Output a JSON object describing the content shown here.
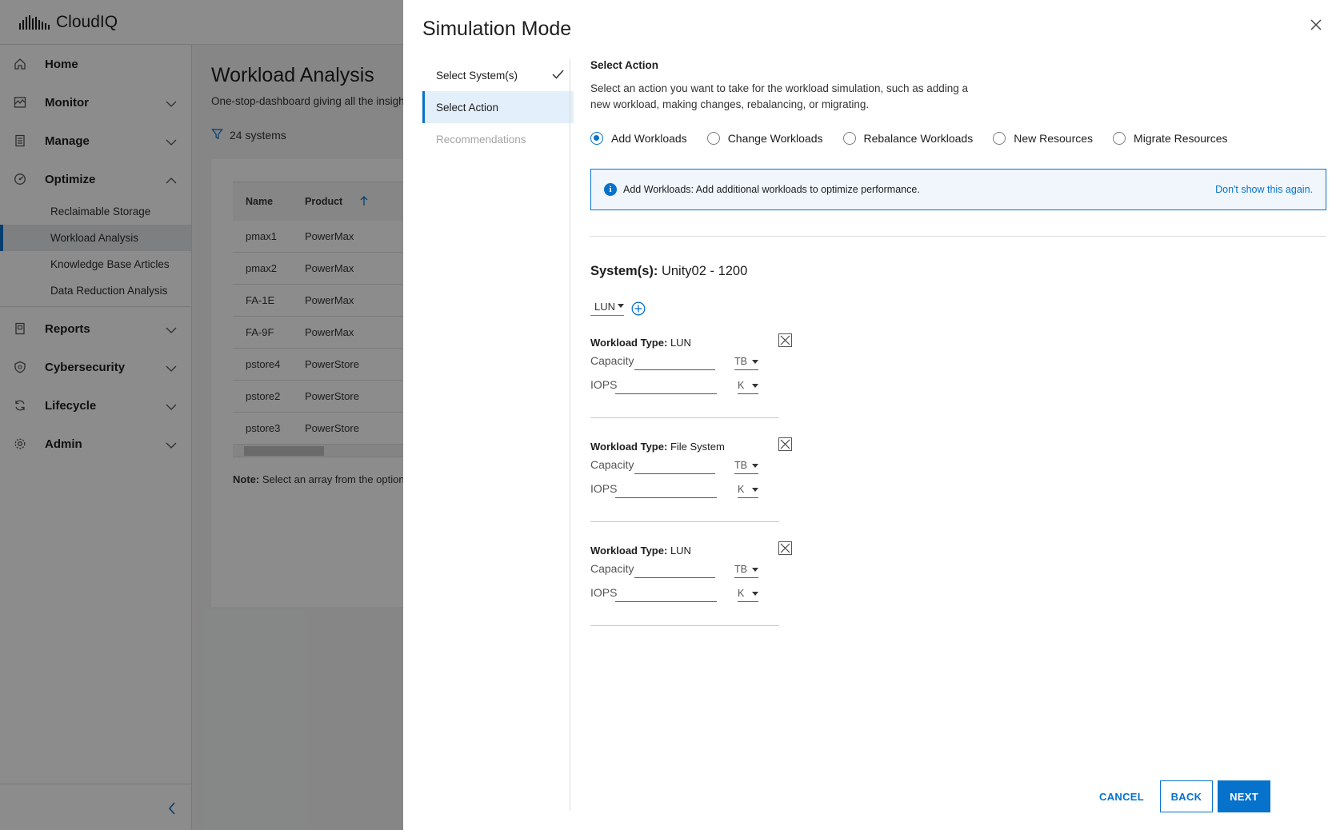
{
  "app": {
    "name": "CloudIQ"
  },
  "sidebar": {
    "items": [
      {
        "label": "Home",
        "icon": "home-icon"
      },
      {
        "label": "Monitor",
        "icon": "monitor-icon"
      },
      {
        "label": "Manage",
        "icon": "manage-icon"
      },
      {
        "label": "Optimize",
        "icon": "optimize-icon"
      },
      {
        "label": "Reports",
        "icon": "reports-icon"
      },
      {
        "label": "Cybersecurity",
        "icon": "shield-icon"
      },
      {
        "label": "Lifecycle",
        "icon": "lifecycle-icon"
      },
      {
        "label": "Admin",
        "icon": "gear-icon"
      }
    ],
    "optimize_sub": [
      {
        "label": "Reclaimable Storage"
      },
      {
        "label": "Workload Analysis",
        "active": true
      },
      {
        "label": "Knowledge Base Articles"
      },
      {
        "label": "Data Reduction Analysis"
      }
    ]
  },
  "page": {
    "title": "Workload Analysis",
    "subtitle": "One-stop-dashboard giving all the insights",
    "filter_text": "24 systems",
    "table": {
      "headers": [
        "Name",
        "Product"
      ],
      "rows": [
        [
          "pmax1",
          "PowerMax"
        ],
        [
          "pmax2",
          "PowerMax"
        ],
        [
          "FA-1E",
          "PowerMax"
        ],
        [
          "FA-9F",
          "PowerMax"
        ],
        [
          "pstore4",
          "PowerStore"
        ],
        [
          "pstore2",
          "PowerStore"
        ],
        [
          "pstore3",
          "PowerStore"
        ]
      ]
    },
    "note_label": "Note:",
    "note_text": "Select an array from the option"
  },
  "modal": {
    "title": "Simulation Mode",
    "steps": [
      {
        "label": "Select System(s)",
        "state": "complete"
      },
      {
        "label": "Select Action",
        "state": "active"
      },
      {
        "label": "Recommendations",
        "state": "disabled"
      }
    ],
    "section_title": "Select Action",
    "section_desc": "Select an action you want to take for the workload simulation, such as adding a new workload, making changes, rebalancing, or migrating.",
    "actions": [
      {
        "label": "Add Workloads",
        "checked": true
      },
      {
        "label": "Change Workloads",
        "checked": false
      },
      {
        "label": "Rebalance Workloads",
        "checked": false
      },
      {
        "label": "New Resources",
        "checked": false
      },
      {
        "label": "Migrate Resources",
        "checked": false
      }
    ],
    "info": {
      "text": "Add Workloads: Add additional workloads to optimize performance.",
      "link": "Don't show this again."
    },
    "systems_label": "System(s):",
    "systems_value": "Unity02 - 1200",
    "workload_type_select": "LUN",
    "workloads": [
      {
        "type_label": "Workload Type:",
        "type": "LUN",
        "capacity_label": "Capacity",
        "capacity_unit": "TB",
        "iops_label": "IOPS",
        "iops_unit": "K"
      },
      {
        "type_label": "Workload Type:",
        "type": "File System",
        "capacity_label": "Capacity",
        "capacity_unit": "TB",
        "iops_label": "IOPS",
        "iops_unit": "K"
      },
      {
        "type_label": "Workload Type:",
        "type": "LUN",
        "capacity_label": "Capacity",
        "capacity_unit": "TB",
        "iops_label": "IOPS",
        "iops_unit": "K"
      }
    ],
    "buttons": {
      "cancel": "CANCEL",
      "back": "BACK",
      "next": "NEXT"
    }
  },
  "colors": {
    "accent": "#0672cb",
    "overlay": "rgba(0,0,0,0.45)"
  }
}
